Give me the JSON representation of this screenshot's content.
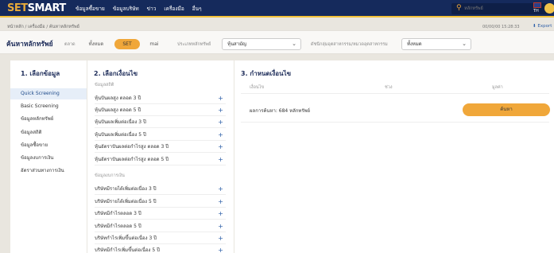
{
  "header": {
    "logo_a": "SET",
    "logo_b": "SMART",
    "nav": [
      "ข้อมูลซื้อขาย",
      "ข้อมูลบริษัท",
      "ข่าว",
      "เครื่องมือ",
      "อื่นๆ"
    ],
    "search_placeholder": "หลักทรัพย์",
    "language": "TH"
  },
  "breadcrumb": "หน้าหลัก / เครื่องมือ / ค้นหาหลักทรัพย์",
  "datetime": "00/00/00 15:28:33",
  "export_label": "Export",
  "page_title": "ค้นหาหลักทรัพย์",
  "filters": {
    "market_label": "ตลาด",
    "market_options": [
      "ทั้งหมด",
      "SET",
      "mai"
    ],
    "type_label": "ประเภทหลักทรัพย์",
    "type_value": "หุ้นสามัญ",
    "industry_label": "ดัชนีกลุ่มอุตสาหกรรม/หมวดอุตสาหกรรม",
    "industry_value": "ทั้งหมด"
  },
  "col1": {
    "title": "1. เลือกข้อมูล",
    "items": [
      "Quick Screening",
      "Basic Screening",
      "ข้อมูลหลักทรัพย์",
      "ข้อมูลสถิติ",
      "ข้อมูลซื้อขาย",
      "ข้อมูลงบการเงิน",
      "อัตราส่วนทางการเงิน"
    ]
  },
  "col2": {
    "title": "2. เลือกเงื่อนไข",
    "group1": "ข้อมูลสถิติ",
    "group1_items": [
      "หุ้นปันผลสูง ตลอด 3 ปี",
      "หุ้นปันผลสูง ตลอด 5 ปี",
      "หุ้นปันผลเพิ่มต่อเนื่อง 3 ปี",
      "หุ้นปันผลเพิ่มต่อเนื่อง 5 ปี",
      "หุ้นอัตราปันผลต่อกำไรสูง ตลอด 3 ปี",
      "หุ้นอัตราปันผลต่อกำไรสูง ตลอด 5 ปี"
    ],
    "group2": "ข้อมูลงบการเงิน",
    "group2_items": [
      "บริษัทมีรายได้เพิ่มต่อเนื่อง 3 ปี",
      "บริษัทมีรายได้เพิ่มต่อเนื่อง 5 ปี",
      "บริษัทมีกำไรตลอด 3 ปี",
      "บริษัทมีกำไรตลอด 5 ปี",
      "บริษัทกำไรเพิ่มขึ้นต่อเนื่อง 3 ปี",
      "บริษัทมีกำไรเพิ่มขึ้นต่อเนื่อง 5 ปี"
    ]
  },
  "col3": {
    "title": "3. กำหนดเงื่อนไข",
    "headers": [
      "เงื่อนไข",
      "ช่วง",
      "มูลค่า"
    ],
    "result_label": "ผลการค้นหา: 684 หลักทรัพย์",
    "search_button": "ค้นหา"
  }
}
